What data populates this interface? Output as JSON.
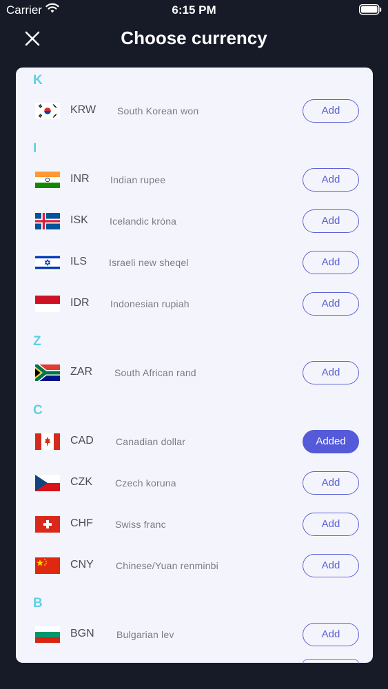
{
  "status": {
    "carrier": "Carrier",
    "time": "6:15 PM"
  },
  "header": {
    "title": "Choose currency"
  },
  "sections": [
    {
      "letter": "K",
      "items": [
        {
          "code": "KRW",
          "name": "South Korean won",
          "button": "Add",
          "flag": "kr-flag"
        }
      ]
    },
    {
      "letter": "I",
      "items": [
        {
          "code": "INR",
          "name": "Indian rupee",
          "button": "Add",
          "flag": "in-flag"
        },
        {
          "code": "ISK",
          "name": "Icelandic króna",
          "button": "Add",
          "flag": "is-flag"
        },
        {
          "code": "ILS",
          "name": "Israeli new sheqel",
          "button": "Add",
          "flag": "il-flag"
        },
        {
          "code": "IDR",
          "name": "Indonesian rupiah",
          "button": "Add",
          "flag": "id-flag"
        }
      ]
    },
    {
      "letter": "Z",
      "items": [
        {
          "code": "ZAR",
          "name": "South African rand",
          "button": "Add",
          "flag": "za-flag"
        }
      ]
    },
    {
      "letter": "C",
      "items": [
        {
          "code": "CAD",
          "name": "Canadian dollar",
          "button": "Added",
          "flag": "ca-flag"
        },
        {
          "code": "CZK",
          "name": "Czech koruna",
          "button": "Add",
          "flag": "cz-flag"
        },
        {
          "code": "CHF",
          "name": "Swiss franc",
          "button": "Add",
          "flag": "ch-flag"
        },
        {
          "code": "CNY",
          "name": "Chinese/Yuan renminbi",
          "button": "Add",
          "flag": "cn-flag"
        }
      ]
    },
    {
      "letter": "B",
      "items": [
        {
          "code": "BGN",
          "name": "Bulgarian lev",
          "button": "Add",
          "flag": "bg-flag"
        }
      ]
    }
  ],
  "colors": {
    "accent": "#545ad9",
    "section_letter": "#5fd0e4",
    "background": "#171a27",
    "card": "#f4f5fc"
  }
}
